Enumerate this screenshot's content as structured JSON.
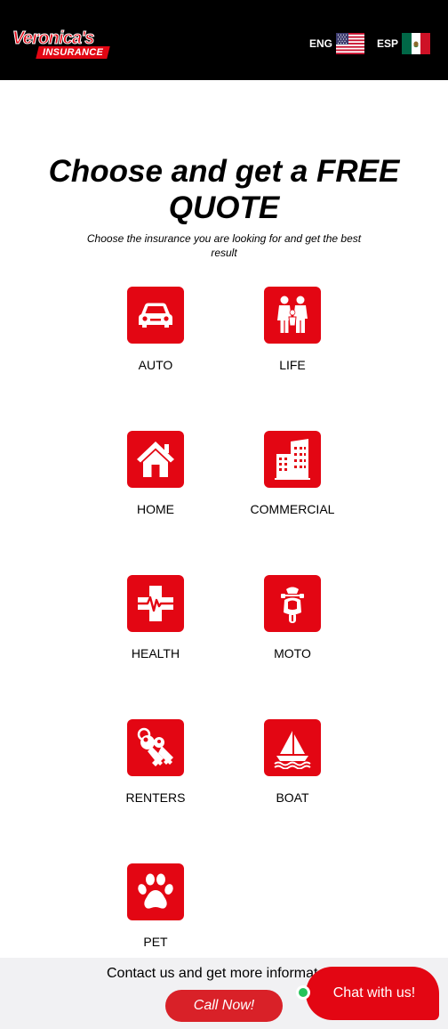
{
  "header": {
    "logo": {
      "line1": "Veronica's",
      "line2": "INSURANCE"
    },
    "languages": [
      {
        "code": "ENG",
        "flag": "us-flag-icon"
      },
      {
        "code": "ESP",
        "flag": "mexico-flag-icon"
      }
    ]
  },
  "hero": {
    "title": "Choose and get a FREE QUOTE",
    "subtitle": "Choose the insurance you are looking for and get the best result"
  },
  "products": [
    {
      "label": "AUTO",
      "icon": "car-icon"
    },
    {
      "label": "LIFE",
      "icon": "family-icon"
    },
    {
      "label": "HOME",
      "icon": "house-icon"
    },
    {
      "label": "COMMERCIAL",
      "icon": "building-icon"
    },
    {
      "label": "HEALTH",
      "icon": "medical-cross-icon"
    },
    {
      "label": "MOTO",
      "icon": "motorcycle-icon"
    },
    {
      "label": "RENTERS",
      "icon": "keys-icon"
    },
    {
      "label": "BOAT",
      "icon": "sailboat-icon"
    },
    {
      "label": "PET",
      "icon": "paw-icon"
    }
  ],
  "footer": {
    "contact_text": "Contact us and get more informat",
    "call_label": "Call Now!",
    "chat_label": "Chat with us!"
  },
  "colors": {
    "accent": "#e30613",
    "header_bg": "#000000",
    "footer_bg": "#f1f1f3",
    "online": "#25c35a"
  }
}
